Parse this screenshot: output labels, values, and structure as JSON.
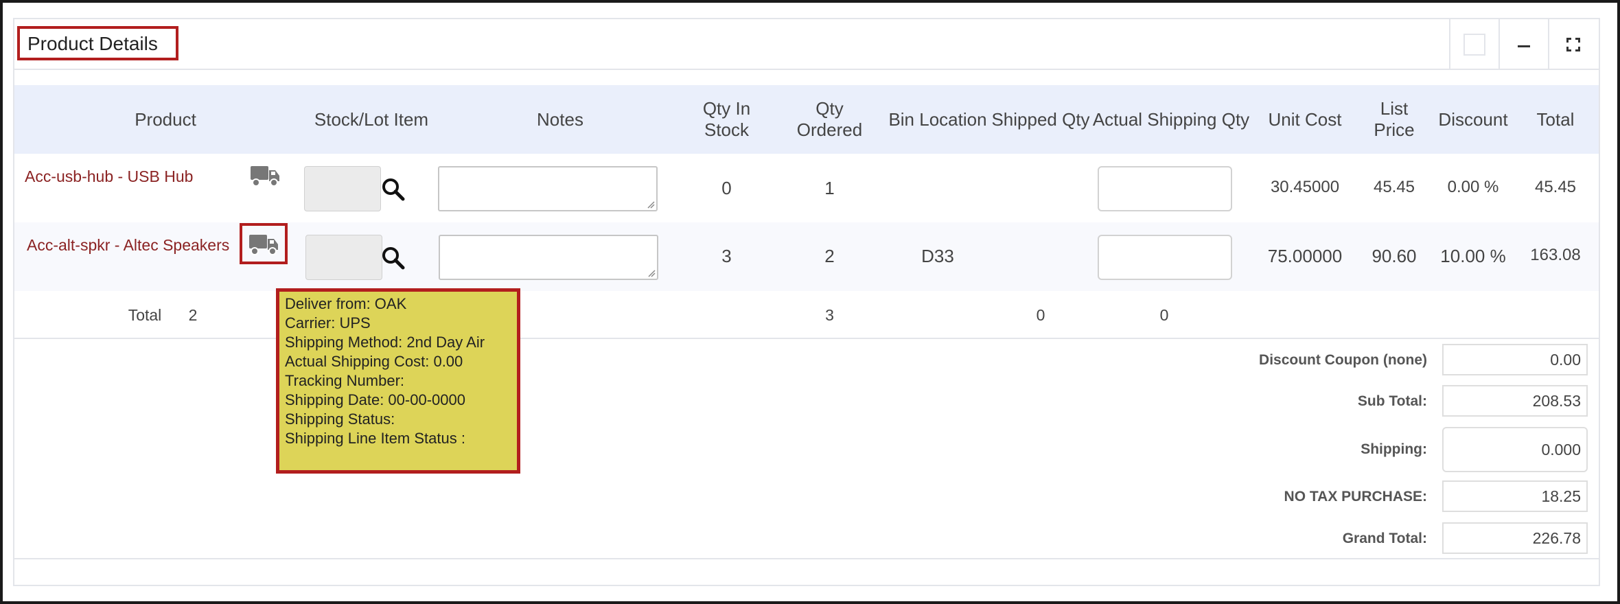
{
  "panel": {
    "title": "Product Details",
    "buttons": [
      "square",
      "minimize",
      "expand"
    ]
  },
  "table": {
    "headers": [
      "Product",
      "Stock/Lot Item",
      "Notes",
      "Qty In Stock",
      "Qty Ordered",
      "Bin Location",
      "Shipped Qty",
      "Actual Shipping Qty",
      "Unit Cost",
      "List Price",
      "Discount",
      "Total"
    ],
    "rows": [
      {
        "product": "Acc-usb-hub - USB Hub",
        "qty_in_stock": "0",
        "qty_ordered": "1",
        "bin_location": "",
        "shipped_qty": "",
        "unit_cost": "30.45000",
        "list_price": "45.45",
        "discount": "0.00 %",
        "total": "45.45"
      },
      {
        "product": "Acc-alt-spkr - Altec Speakers",
        "qty_in_stock": "3",
        "qty_ordered": "2",
        "bin_location": "D33",
        "shipped_qty": "",
        "unit_cost": "75.00000",
        "list_price": "90.60",
        "discount": "10.00 %",
        "total": "163.08"
      }
    ],
    "totals": {
      "label": "Total",
      "count": "2",
      "qty_ordered": "3",
      "shipped_qty": "0",
      "actual_shipping_qty": "0"
    }
  },
  "summary": {
    "discount_coupon": {
      "label": "Discount Coupon (none)",
      "value": "0.00"
    },
    "sub_total": {
      "label": "Sub Total:",
      "value": "208.53"
    },
    "shipping": {
      "label": "Shipping:",
      "value": "0.000"
    },
    "tax": {
      "label": "NO TAX PURCHASE:",
      "value": "18.25"
    },
    "grand_total": {
      "label": "Grand Total:",
      "value": "226.78"
    }
  },
  "tooltip": {
    "lines": [
      "Deliver from: OAK",
      "Carrier: UPS",
      "Shipping Method: 2nd Day Air",
      "Actual Shipping Cost: 0.00",
      "Tracking Number:",
      "Shipping Date: 00-00-0000",
      "Shipping Status:",
      "Shipping Line Item Status :"
    ]
  },
  "colors": {
    "header_bg": "#eaeffb",
    "link": "#8b2323",
    "highlight_border": "#b21e1e",
    "tooltip_bg": "#ddd458"
  },
  "icons": [
    "truck-icon",
    "search-icon",
    "square-icon",
    "minimize-icon",
    "expand-icon"
  ]
}
